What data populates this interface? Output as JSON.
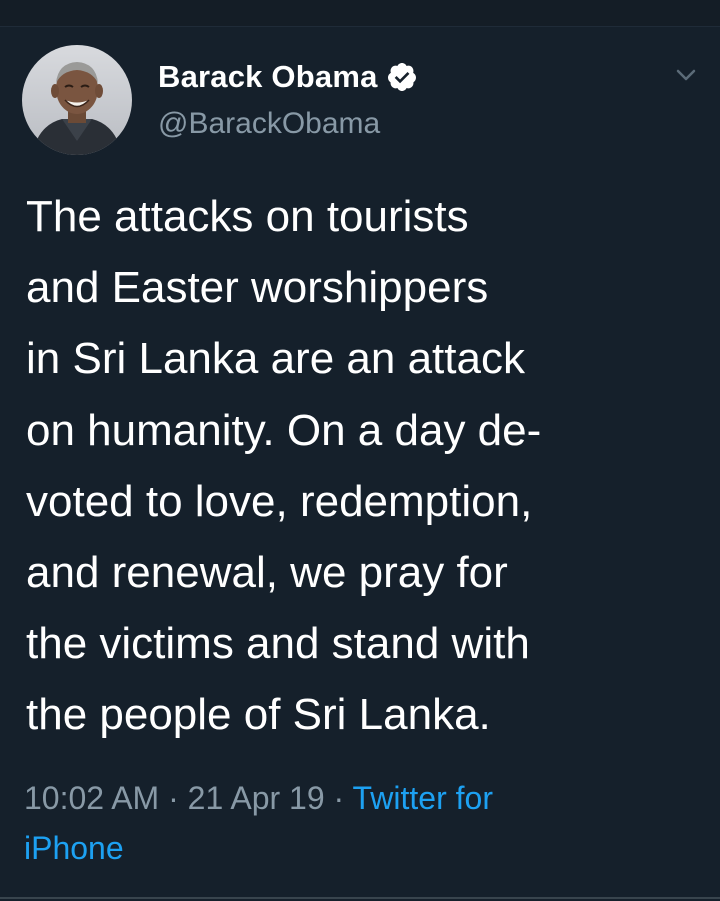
{
  "tweet": {
    "display_name": "Barack Obama",
    "handle": "@BarackObama",
    "verified": true,
    "text_lines": [
      "The attacks on tourists",
      "and Easter worshippers",
      "in Sri Lanka are an attack",
      "on humanity. On a day de-",
      "voted to love, redemption,",
      "and renewal, we pray for",
      "the victims and stand with",
      "the people of Sri Lanka."
    ],
    "time": "10:02 AM",
    "date": "21 Apr 19",
    "separator": "·",
    "source_part1": "Twitter for",
    "source_part2": "iPhone"
  },
  "colors": {
    "background": "#15202b",
    "text": "#ffffff",
    "secondary_text": "#8899a6",
    "link": "#1da1f2",
    "divider": "#38444d"
  },
  "icons": {
    "verified": "verified-badge-icon",
    "menu": "chevron-down-icon",
    "avatar": "profile-avatar"
  }
}
